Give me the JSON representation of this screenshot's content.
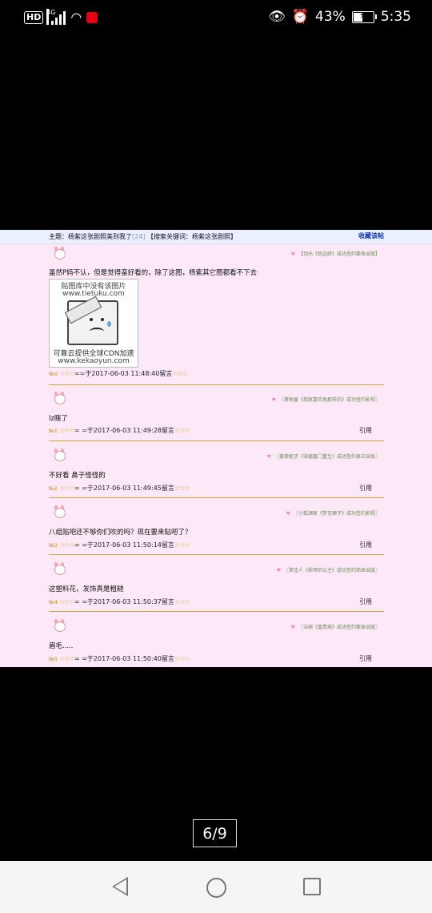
{
  "status_bar": {
    "hd": "HD",
    "network": "4G",
    "battery_percent": "43%",
    "battery_level": 0.43,
    "time": "5:35"
  },
  "topic_bar": {
    "topic_label": "主题：杨紫这张剧照美到我了",
    "reply_count": "[24]",
    "search_keyword": "【搜索关键词：杨紫这张剧照】",
    "favorite_label": "收藏该帖"
  },
  "placeholder_image": {
    "line1": "贴图库中没有该图片",
    "line2": "www.tietuku.com",
    "line3": "可靠云提供全球CDN加速",
    "line4": "www.kekaoyun.com"
  },
  "posts": [
    {
      "signature": "【顶光《枕边娇》成功签约繁体出版】",
      "text": "虽然P妈不认，但是觉得蛮好看的，除了这图，杨紫其它图都看不下去",
      "floor": "№0",
      "meta": "==于2017-06-03 11:48:40留言",
      "quote": ""
    },
    {
      "signature": "〖蒋牧童《我就喜欢他那样的》成功签约影视〗",
      "text": "lz瞎了",
      "floor": "№1",
      "meta": "= =于2017-06-03 11:49:28留言",
      "quote": "引用"
    },
    {
      "signature": "〖姜荷妮子《宠婚蜜门重生》成功签约泰文出版〗",
      "text": "不好看 鼻子怪怪的",
      "floor": "№2",
      "meta": "= =于2017-06-03 11:49:45留言",
      "quote": "引用"
    },
    {
      "signature": "〖小狐酒家《梦见狮子》成功签约影视〗",
      "text": "八组贴吧还不够你们吹的吗？现在要来贴吧了？",
      "floor": "№3",
      "meta": "= =于2017-06-03 11:50:14留言",
      "quote": "引用"
    },
    {
      "signature": "〖笑佳人《影帝的公主》成功签约简体出版〗",
      "text": "这塑料花，发饰真是粗糙",
      "floor": "№4",
      "meta": "= =于2017-06-03 11:50:37留言",
      "quote": "引用"
    },
    {
      "signature": "〖治崩《富贵病》成功签约繁体出版〗",
      "text": "眉毛.....",
      "floor": "№5",
      "meta": "= =于2017-06-03 11:50:40留言",
      "quote": "引用"
    }
  ],
  "stars": "☆☆☆",
  "page_indicator": "6/9"
}
